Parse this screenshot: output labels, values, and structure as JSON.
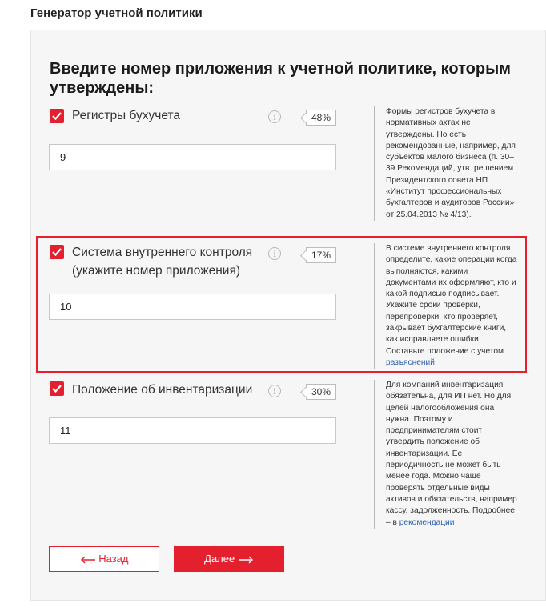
{
  "page_title": "Генератор учетной политики",
  "heading": "Введите номер приложения к учетной политике, которым утверждены:",
  "items": [
    {
      "checked": true,
      "label": "Регистры бухучета",
      "label_line2": "",
      "info_icon": "info-icon",
      "percent": "48%",
      "value": "9",
      "note_text": "Формы регистров бухучета в нормативных актах не утверждены. Но есть рекомендованные, например, для субъектов малого бизнеса (п. 30–39 Рекомендаций, утв. решением Президентского совета НП «Институт профессиональных бухгалтеров и аудиторов России» от 25.04.2013 № 4/13).",
      "note_link": ""
    },
    {
      "checked": true,
      "label": "Система внутреннего контроля",
      "label_line2": "(укажите номер приложения)",
      "info_icon": "info-icon",
      "percent": "17%",
      "value": "10",
      "note_text": "В системе внутреннего контроля определите, какие операции когда выполняются, какими документами их оформляют, кто и какой подписью подписывает. Укажите сроки проверки, перепроверки, кто проверяет, закрывает бухгалтерские книги, как исправляете ошибки. Составьте положение с учетом ",
      "note_link": "разъяснений"
    },
    {
      "checked": true,
      "label": "Положение об инвентаризации",
      "label_line2": "",
      "info_icon": "info-icon",
      "percent": "30%",
      "value": "11",
      "note_text": "Для компаний инвентаризация обязательна, для ИП нет. Но для целей налогообложения она нужна. Поэтому и предпринимателям стоит утвердить положение об инвентаризации. Ее периодичность не может быть менее года. Можно чаще проверять отдельные виды активов и обязательств, например кассу, задолженность. Подробнее – в ",
      "note_link": "рекомендации"
    }
  ],
  "buttons": {
    "back": "Назад",
    "next": "Далее"
  },
  "colors": {
    "accent": "#e4202f",
    "link": "#2a5db0",
    "panel_bg": "#f6f6f6"
  }
}
